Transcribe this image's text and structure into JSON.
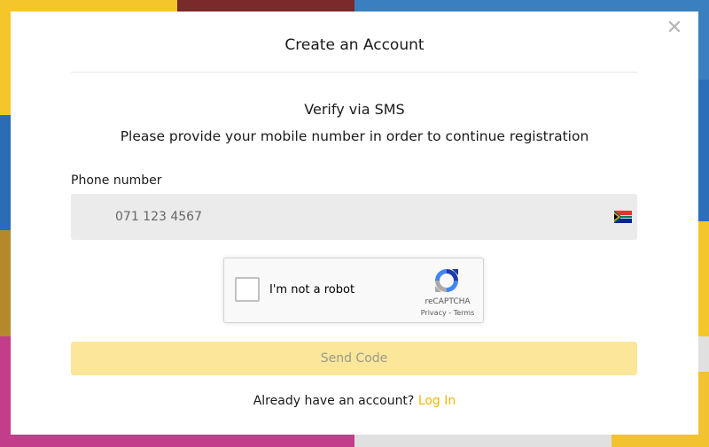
{
  "modal": {
    "title": "Create an Account",
    "close_icon": "close-icon"
  },
  "verify": {
    "title": "Verify via SMS",
    "instructions": "Please provide your mobile number in order to continue registration"
  },
  "phone": {
    "label": "Phone number",
    "placeholder": "071 123 4567",
    "value": "",
    "country_flag": "south-africa-flag-icon"
  },
  "recaptcha": {
    "label": "I'm not a robot",
    "brand": "reCAPTCHA",
    "privacy": "Privacy",
    "separator": " - ",
    "terms": "Terms"
  },
  "send_button": {
    "label": "Send Code",
    "bg_color": "#fbe69a"
  },
  "footer": {
    "prompt": "Already have an account? ",
    "login_label": "Log In",
    "link_color": "#f2b705"
  }
}
